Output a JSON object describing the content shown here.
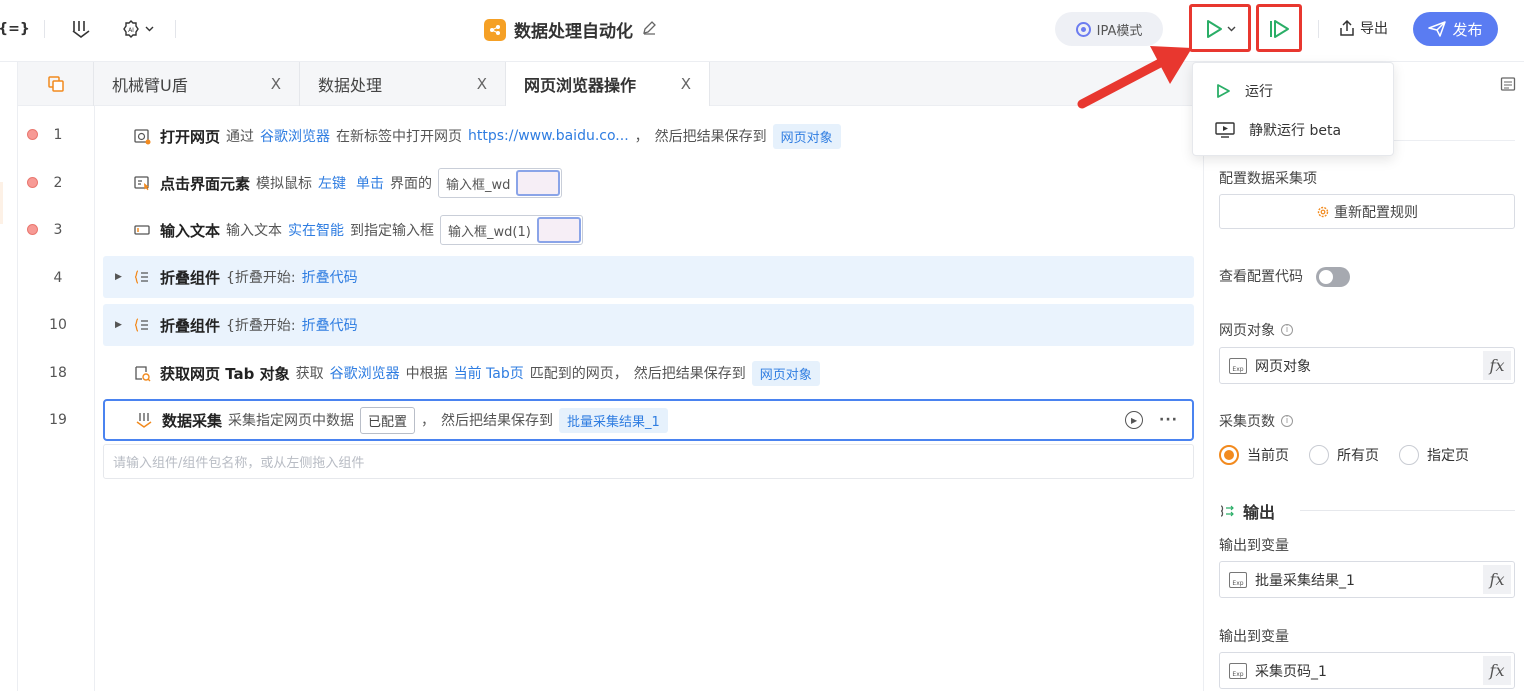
{
  "toolbar": {
    "left_icon_1": "{=}",
    "title": "数据处理自动化",
    "ipa_label": "IPA模式",
    "export_label": "导出",
    "publish_label": "发布"
  },
  "run_menu": {
    "items": [
      {
        "label": "运行"
      },
      {
        "label": "静默运行 beta"
      }
    ]
  },
  "tabs": [
    {
      "label": "机械臂U盾",
      "close": "X"
    },
    {
      "label": "数据处理",
      "close": "X"
    },
    {
      "label": "网页浏览器操作",
      "close": "X"
    }
  ],
  "lines": [
    "1",
    "2",
    "3",
    "4",
    "10",
    "18",
    "19"
  ],
  "steps": {
    "s1": {
      "title": "打开网页",
      "t1": "通过",
      "l1": "谷歌浏览器",
      "t2": "在新标签中打开网页",
      "l2": "https://www.baidu.co...",
      "t3": "，",
      "t4": "然后把结果保存到",
      "chip": "网页对象"
    },
    "s2": {
      "title": "点击界面元素",
      "t1": "模拟鼠标",
      "l1": "左键",
      "l2": "单击",
      "t2": "界面的",
      "box": "输入框_wd"
    },
    "s3": {
      "title": "输入文本",
      "t1": "输入文本",
      "l1": "实在智能",
      "t2": "到指定输入框",
      "box": "输入框_wd(1)"
    },
    "s4": {
      "title": "折叠组件",
      "t1": "{折叠开始:",
      "l1": "折叠代码"
    },
    "s5": {
      "title": "折叠组件",
      "t1": "{折叠开始:",
      "l1": "折叠代码"
    },
    "s6": {
      "title": "获取网页 Tab 对象",
      "t1": "获取",
      "l1": "谷歌浏览器",
      "t2": "中根据",
      "l2": "当前 Tab页",
      "t3": "匹配到的网页，",
      "t4": "然后把结果保存到",
      "chip": "网页对象"
    },
    "s7": {
      "title": "数据采集",
      "t1": "采集指定网页中数据",
      "conf": "已配置",
      "t2": "，",
      "t3": "然后把结果保存到",
      "chip": "批量采集结果_1"
    }
  },
  "add_placeholder": "请输入组件/组件包名称，或从左侧拖入组件",
  "panel": {
    "config_label": "配置数据采集项",
    "reconfig_button": "重新配置规则",
    "view_code_label": "查看配置代码",
    "view_code_on": false,
    "web_object_label": "网页对象",
    "web_object_value": "网页对象",
    "pages_label": "采集页数",
    "pages_options": [
      "当前页",
      "所有页",
      "指定页"
    ],
    "pages_selected": "当前页",
    "output_section": "输出",
    "output1_label": "输出到变量",
    "output1_value": "批量采集结果_1",
    "output2_label": "输出到变量",
    "output2_value": "采集页码_1",
    "fx": "fx",
    "exp": "Exp"
  },
  "colors": {
    "accent": "#5a7cf2",
    "link": "#2f7de1",
    "highlight_box": "#e8372f",
    "run_green": "#2aae67",
    "radio": "#f28a1e"
  }
}
